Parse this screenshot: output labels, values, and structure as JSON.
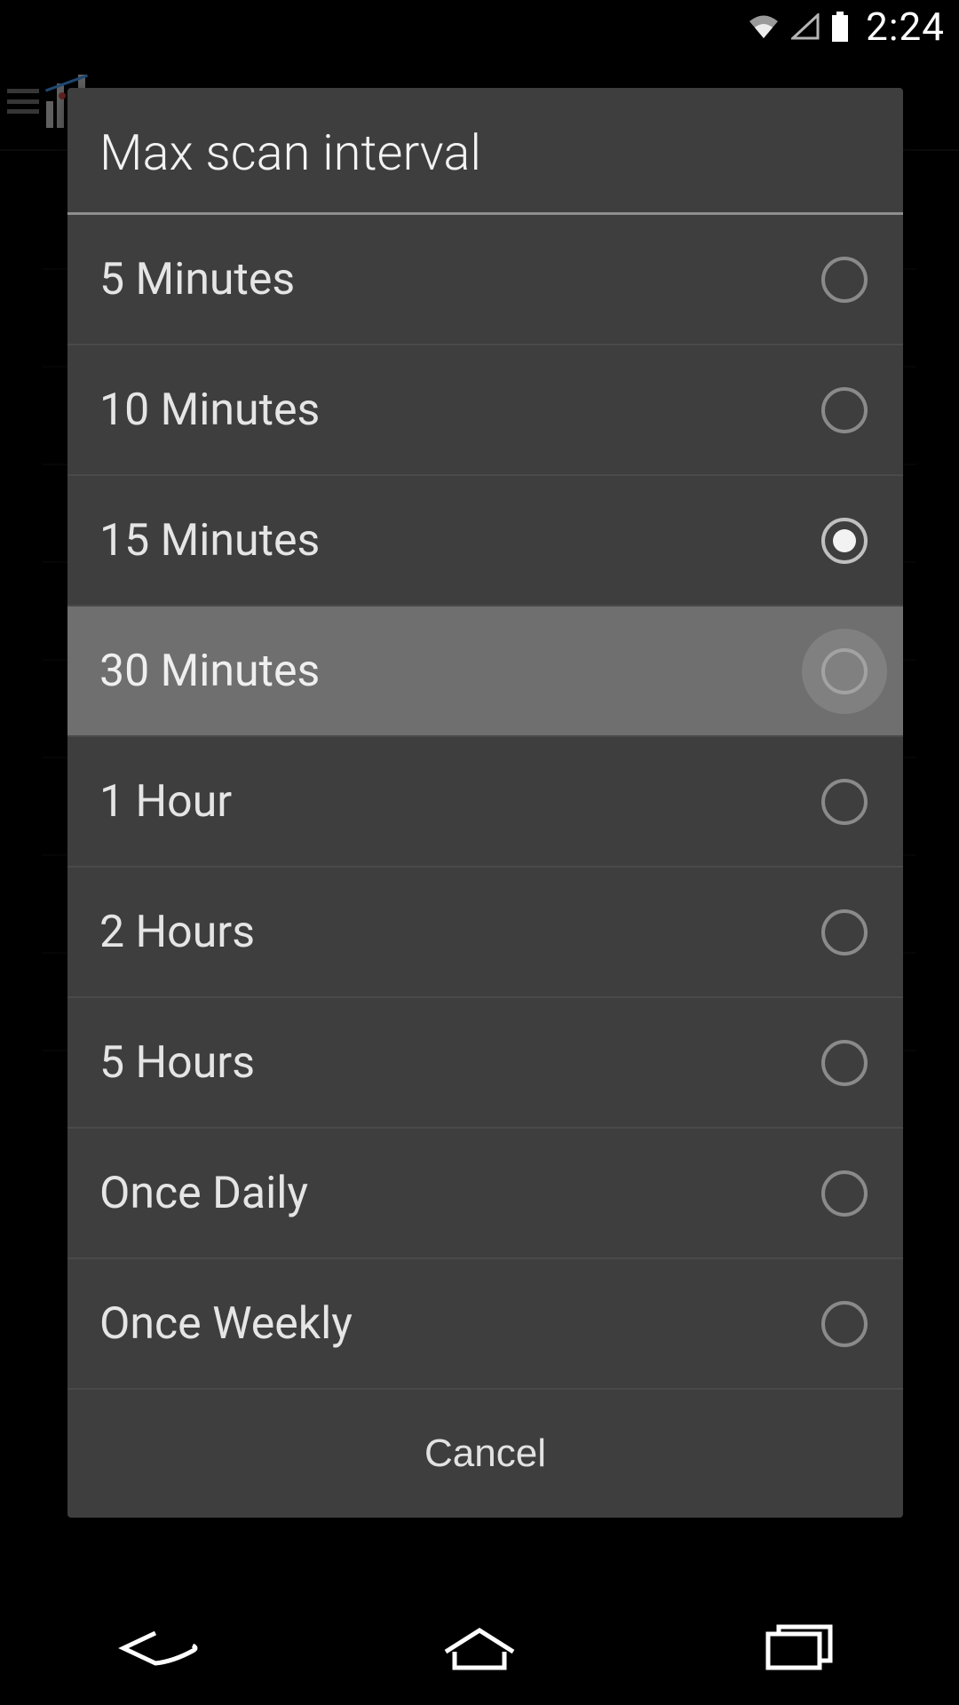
{
  "statusbar": {
    "time": "2:24",
    "wifi_icon": "wifi",
    "signal_icon": "cellular",
    "battery_icon": "battery-full"
  },
  "dialog": {
    "title": "Max scan interval",
    "cancel_label": "Cancel",
    "selected_index": 2,
    "highlighted_index": 3,
    "options": [
      {
        "label": "5 Minutes"
      },
      {
        "label": "10 Minutes"
      },
      {
        "label": "15 Minutes"
      },
      {
        "label": "30 Minutes"
      },
      {
        "label": "1 Hour"
      },
      {
        "label": "2 Hours"
      },
      {
        "label": "5 Hours"
      },
      {
        "label": "Once Daily"
      },
      {
        "label": "Once Weekly"
      }
    ]
  },
  "navbar": {
    "back": "back",
    "home": "home",
    "recents": "recents"
  }
}
